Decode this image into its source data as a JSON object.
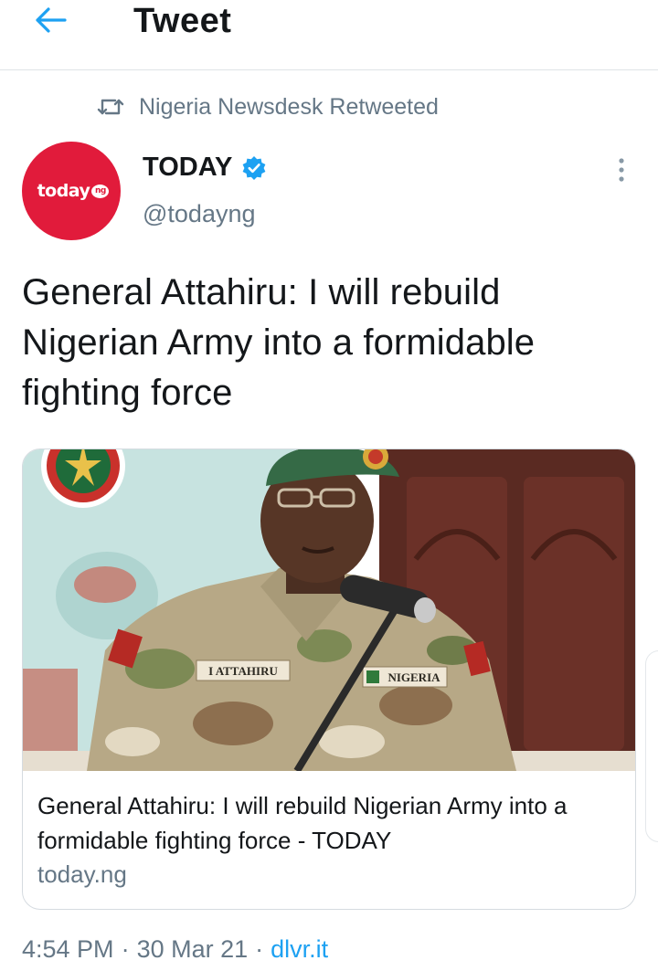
{
  "header": {
    "title": "Tweet",
    "back_icon": "arrow-left-icon"
  },
  "retweet": {
    "icon": "retweet-icon",
    "text": "Nigeria Newsdesk Retweeted"
  },
  "author": {
    "name": "TODAY",
    "handle": "@todayng",
    "verified": true,
    "avatar_logo_text": "today",
    "avatar_logo_badge": "ng",
    "avatar_color": "#e11b3b"
  },
  "tweet": {
    "text": "General Attahiru: I will rebuild Nigerian Army into a formidable fighting force"
  },
  "card": {
    "image_labels": {
      "name_tag": "I ATTAHIRU",
      "country_tag": "NIGERIA"
    },
    "title": "General Attahiru: I will rebuild Nigerian Army into a formidable fighting force - TODAY",
    "domain": "today.ng"
  },
  "meta": {
    "time": "4:54 PM",
    "date": "30 Mar 21",
    "separator": "·",
    "source": "dlvr.it"
  },
  "colors": {
    "accent": "#1da1f2",
    "secondary_text": "#657786",
    "primary_text": "#14171a"
  }
}
